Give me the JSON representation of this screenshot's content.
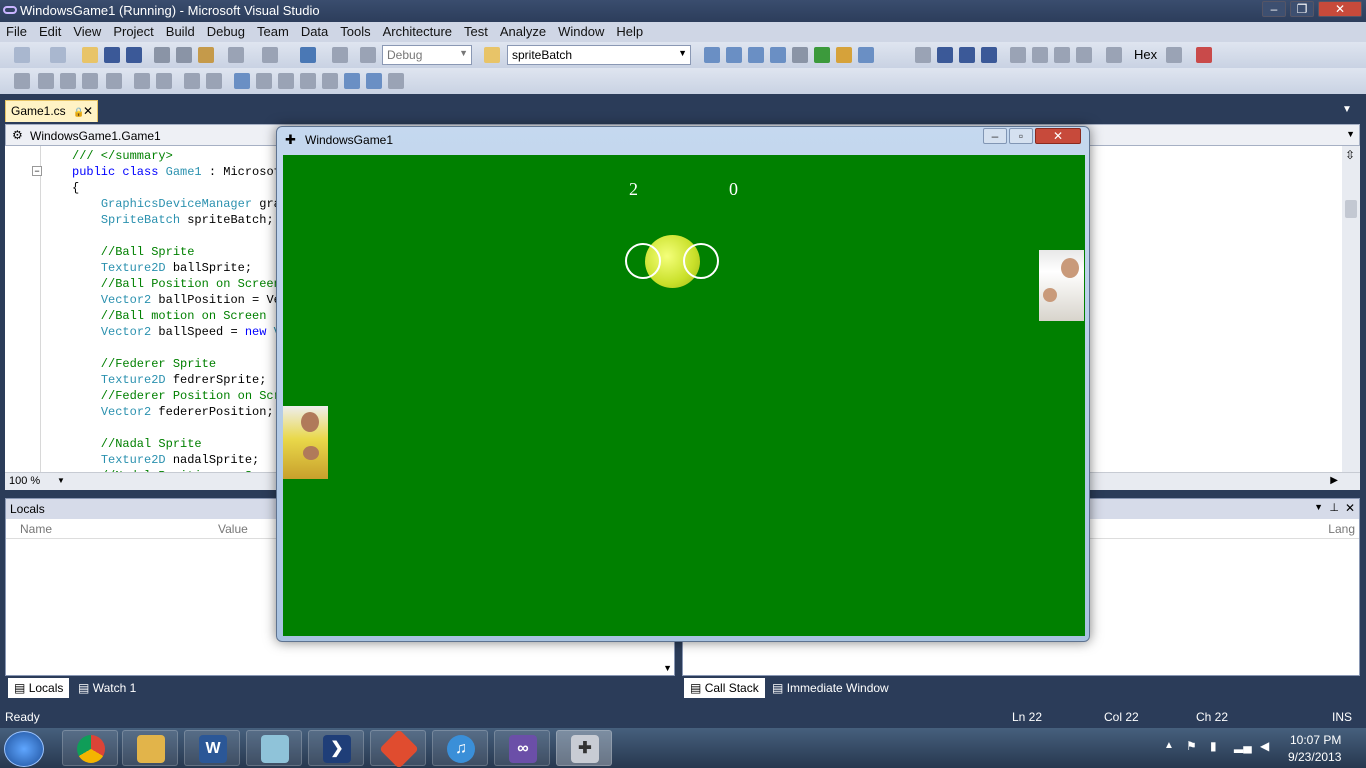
{
  "window": {
    "title": "WindowsGame1 (Running) - Microsoft Visual Studio"
  },
  "menu": [
    "File",
    "Edit",
    "View",
    "Project",
    "Build",
    "Debug",
    "Team",
    "Data",
    "Tools",
    "Architecture",
    "Test",
    "Analyze",
    "Window",
    "Help"
  ],
  "toolbar": {
    "config": "Debug",
    "find_value": "spriteBatch",
    "hex_label": "Hex"
  },
  "editor": {
    "tab_label": "Game1.cs",
    "type_selector": "WindowsGame1.Game1",
    "zoom": "100 %",
    "code_lines": [
      "/// </summary>",
      "public class Game1 : Microsof",
      "{",
      "    GraphicsDeviceManager gra",
      "    SpriteBatch spriteBatch;",
      "",
      "    //Ball Sprite",
      "    Texture2D ballSprite;",
      "    //Ball Position on Screen",
      "    Vector2 ballPosition = Ve",
      "    //Ball motion on Screen",
      "    Vector2 ballSpeed = new V",
      "",
      "    //Federer Sprite",
      "    Texture2D fedrerSprite;",
      "    //Federer Position on Scr",
      "    Vector2 federerPosition;",
      "",
      "    //Nadal Sprite",
      "    Texture2D nadalSprite;",
      "    //Nadal Position on S"
    ]
  },
  "locals": {
    "title": "Locals",
    "col_name": "Name",
    "col_value": "Value",
    "col_lang": "Lang"
  },
  "bottom_tabs": [
    "Locals",
    "Watch 1",
    "Call Stack",
    "Immediate Window"
  ],
  "status": {
    "text": "Ready",
    "line": "Ln 22",
    "col": "Col 22",
    "ch": "Ch 22",
    "mode": "INS"
  },
  "game": {
    "title": "WindowsGame1",
    "score_left": "2",
    "score_right": "0",
    "background": "#008000"
  },
  "clock": {
    "time": "10:07 PM",
    "date": "9/23/2013"
  }
}
